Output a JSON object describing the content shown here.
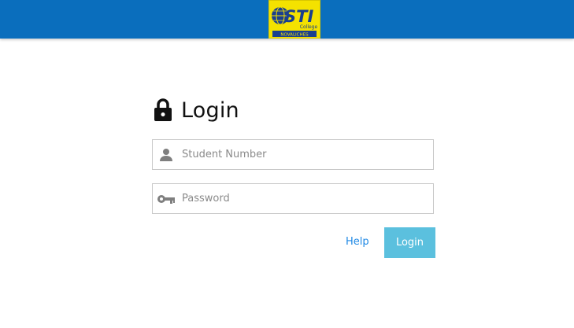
{
  "header": {
    "logo": {
      "brand": "STI",
      "sub": "College",
      "campus": "NOVALICHES",
      "bg_color": "#f4e200",
      "text_color": "#1a3f8f"
    },
    "bar_color": "#0a6ebd"
  },
  "login": {
    "title": "Login",
    "title_icon": "lock-icon",
    "student_number": {
      "placeholder": "Student Number",
      "value": "",
      "icon": "person-icon"
    },
    "password": {
      "placeholder": "Password",
      "value": "",
      "icon": "key-icon"
    },
    "help_label": "Help",
    "login_label": "Login",
    "login_button_color": "#5bc0de",
    "help_color": "#1e88e5"
  }
}
